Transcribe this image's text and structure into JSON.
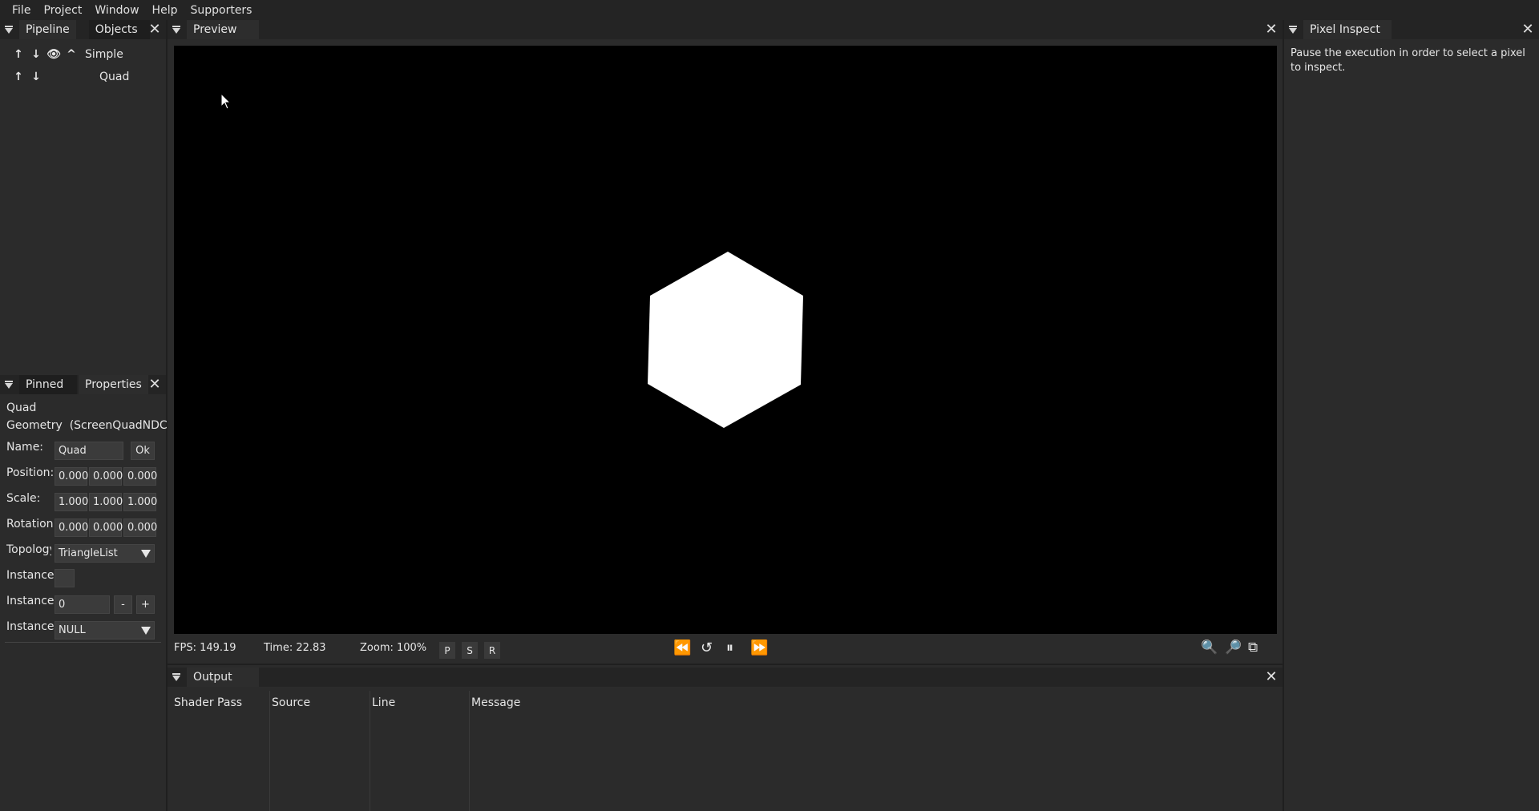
{
  "menu": [
    "File",
    "Project",
    "Window",
    "Help",
    "Supporters"
  ],
  "pipeline_panel": {
    "tabs": [
      "Pipeline",
      "Objects"
    ],
    "items": [
      {
        "label": "Simple",
        "icons": [
          "up-arrow",
          "down-arrow",
          "eye",
          "chevron-up"
        ]
      },
      {
        "label": "Quad",
        "icons": [
          "up-arrow",
          "down-arrow"
        ]
      }
    ]
  },
  "properties_panel": {
    "tabs": [
      "Pinned",
      "Properties"
    ],
    "object_name": "Quad",
    "object_type": "Geometry  (ScreenQuadNDC)",
    "name_label": "Name:",
    "name_value": "Quad",
    "ok_label": "Ok",
    "position_label": "Position:",
    "position": [
      "0.000",
      "0.000",
      "0.000"
    ],
    "scale_label": "Scale:",
    "scale": [
      "1.000",
      "1.000",
      "1.000"
    ],
    "rotation_label": "Rotation",
    "rotation": [
      "0.000",
      "0.000",
      "0.000"
    ],
    "topology_label": "Topology",
    "topology_value": "TriangleList",
    "instance_label_1": "Instance",
    "instance_label_2": "Instance",
    "instance_count": "0",
    "minus": "-",
    "plus": "+",
    "instance_label_3": "Instance",
    "instance_buffer": "NULL"
  },
  "preview_panel": {
    "tab": "Preview",
    "fps": "FPS: 149.19",
    "time": "Time: 22.83",
    "zoom": "Zoom: 100%",
    "mode_buttons": [
      "P",
      "S",
      "R"
    ],
    "shape_color": "#ffffff"
  },
  "output_panel": {
    "tab": "Output",
    "columns": [
      "Shader Pass",
      "Source",
      "Line",
      "Message"
    ]
  },
  "pixel_inspect_panel": {
    "tab": "Pixel Inspect",
    "message": "Pause the execution in order to select a pixel to inspect."
  }
}
